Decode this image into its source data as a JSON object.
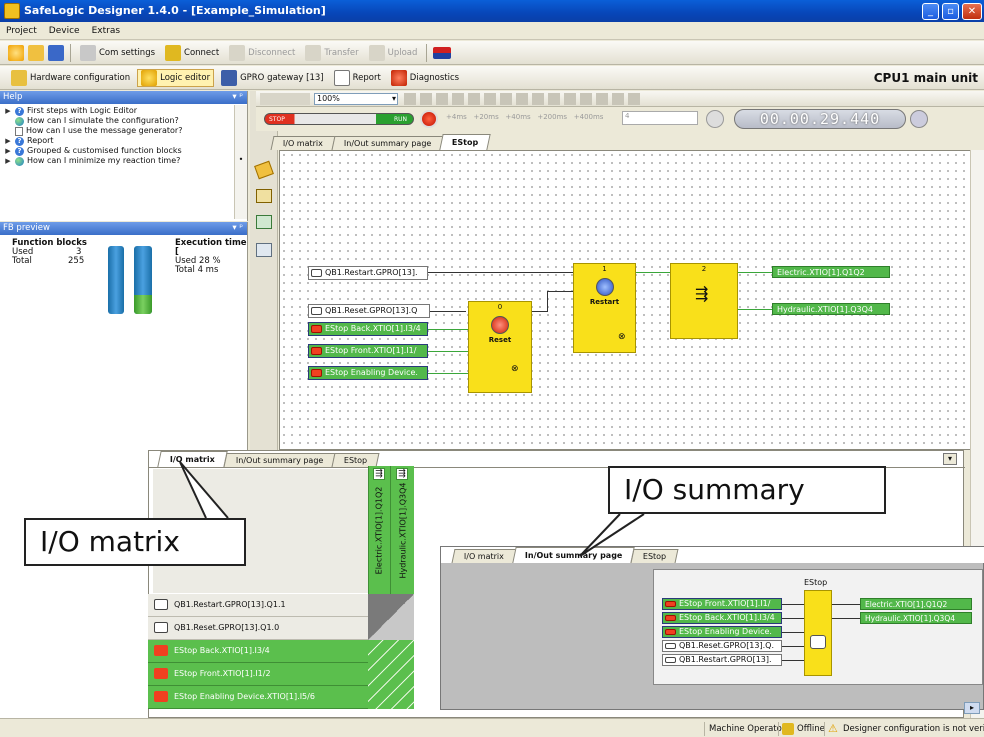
{
  "window": {
    "title": "SafeLogic Designer 1.4.0 - [Example_Simulation]"
  },
  "menu": [
    "Project",
    "Device",
    "Extras"
  ],
  "toolbar1": {
    "com_settings": "Com settings",
    "connect": "Connect",
    "disconnect": "Disconnect",
    "transfer": "Transfer",
    "upload": "Upload"
  },
  "toolbar2": {
    "hardware": "Hardware configuration",
    "logic": "Logic editor",
    "gateway": "GPRO gateway [13]",
    "report": "Report",
    "diagnostics": "Diagnostics",
    "cpu": "CPU1 main unit"
  },
  "help": {
    "title": "Help",
    "items": [
      "First steps with Logic Editor",
      "How can I simulate the configuration?",
      "How can I use the message generator?",
      "Report",
      "Grouped & customised function blocks",
      "How can I minimize my reaction time?"
    ]
  },
  "fb_preview": {
    "title": "FB preview",
    "fb_header": "Function blocks",
    "fb_used_label": "Used",
    "fb_used": "3",
    "fb_total_label": "Total",
    "fb_total": "255",
    "exec_header": "Execution time [",
    "exec_used_label": "Used",
    "exec_used": "28 %",
    "exec_total_label": "Total",
    "exec_total": "4 ms",
    "exec_used_fraction": 0.28
  },
  "sim": {
    "zoom": "100%",
    "stop": "STOP",
    "run": "RUN",
    "steps": [
      "+4ms",
      "+20ms",
      "+40ms",
      "+200ms",
      "+400ms"
    ],
    "step_value": "4",
    "timer": "00.00.29.440"
  },
  "tabs": [
    "I/O matrix",
    "In/Out summary page",
    "EStop"
  ],
  "diagram": {
    "inputs": [
      "QB1.Restart.GPRO[13].",
      "QB1.Reset.GPRO[13].Q",
      "EStop Back.XTIO[1].I3/4",
      "EStop Front.XTIO[1].I1/",
      "EStop Enabling Device."
    ],
    "outputs": [
      "Electric.XTIO[1].Q1Q2",
      "Hydraulic.XTIO[1].Q3Q4"
    ],
    "blocks": [
      {
        "num": "0",
        "label": "Reset"
      },
      {
        "num": "1",
        "label": "Restart"
      },
      {
        "num": "2",
        "label": ""
      }
    ]
  },
  "matrix": {
    "tabs": [
      "I/O matrix",
      "In/Out summary page",
      "EStop"
    ],
    "columns": [
      "Electric.XTIO[1].Q1Q2",
      "Hydraulic.XTIO[1].Q3Q4"
    ],
    "rows": [
      "QB1.Restart.GPRO[13].Q1.1",
      "QB1.Reset.GPRO[13].Q1.0",
      "EStop Back.XTIO[1].I3/4",
      "EStop Front.XTIO[1].I1/2",
      "EStop Enabling Device.XTIO[1].I5/6"
    ]
  },
  "summary": {
    "tabs": [
      "I/O matrix",
      "In/Out summary page",
      "EStop"
    ],
    "block_title": "EStop",
    "inputs": [
      "EStop Front.XTIO[1].I1/",
      "EStop Back.XTIO[1].I3/4",
      "EStop Enabling Device.",
      "QB1.Reset.GPRO[13].Q.",
      "QB1.Restart.GPRO[13]."
    ],
    "outputs": [
      "Electric.XTIO[1].Q1Q2",
      "Hydraulic.XTIO[1].Q3Q4"
    ]
  },
  "callouts": {
    "io_matrix": "I/O matrix",
    "io_summary": "I/O summary"
  },
  "status": {
    "user": "Machine Operator",
    "mode": "Offline",
    "message": "Designer configuration is not verified"
  }
}
